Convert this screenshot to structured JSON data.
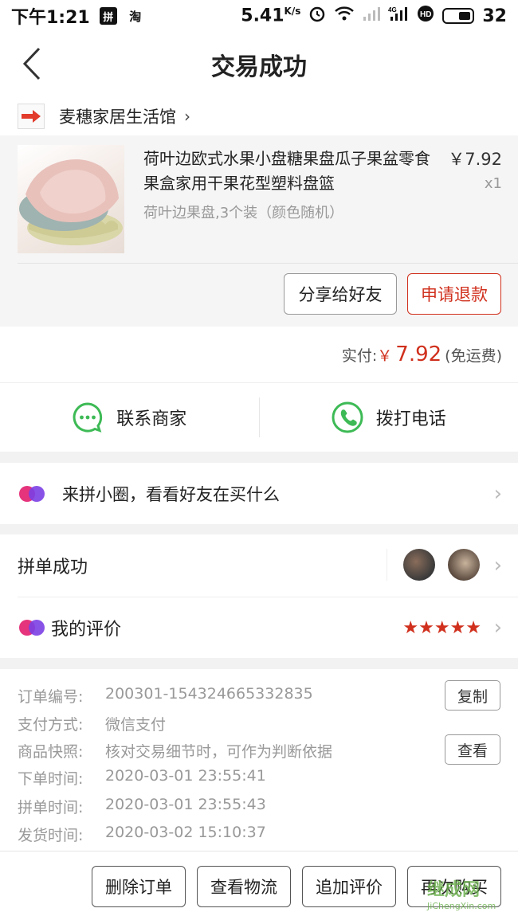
{
  "status_bar": {
    "time": "下午1:21",
    "app_badge_1": "拼",
    "app_badge_2": "淘",
    "speed": "5.41",
    "speed_unit": "K/s",
    "battery": "32"
  },
  "header": {
    "title": "交易成功"
  },
  "shop": {
    "name": "麦穗家居生活馆",
    "chevron": "›"
  },
  "product": {
    "title": "荷叶边欧式水果小盘糖果盘瓜子果盆零食果盒家用干果花型塑料盘篮",
    "spec": "荷叶边果盘,3个装（颜色随机）",
    "price": "￥7.92",
    "qty": "x1",
    "share_button": "分享给好友",
    "refund_button": "申请退款"
  },
  "payment": {
    "label": "实付:",
    "currency": "￥",
    "amount": "7.92",
    "note": "(免运费)"
  },
  "contact": {
    "merchant": "联系商家",
    "phone": "拨打电话"
  },
  "circle": {
    "text": "来拼小圈，看看好友在买什么"
  },
  "group": {
    "label": "拼单成功"
  },
  "review": {
    "label": "我的评价",
    "stars": "★★★★★",
    "rating": 5
  },
  "order_info": {
    "order_no_label": "订单编号:",
    "order_no": "200301-154324665332835",
    "copy_button": "复制",
    "pay_method_label": "支付方式:",
    "pay_method": "微信支付",
    "snapshot_label": "商品快照:",
    "snapshot": "核对交易细节时，可作为判断依据",
    "view_button": "查看",
    "order_time_label": "下单时间:",
    "order_time": "2020-03-01 23:55:41",
    "group_time_label": "拼单时间:",
    "group_time": "2020-03-01 23:55:43",
    "ship_time_label": "发货时间:",
    "ship_time": "2020-03-02 15:10:37"
  },
  "bottom_bar": {
    "delete": "删除订单",
    "logistics": "查看物流",
    "add_review": "追加评价",
    "buy_again": "再次购买"
  },
  "watermark": {
    "top": "继成网",
    "bottom": "JiChengXin.com"
  },
  "colors": {
    "accent_red": "#d0301d",
    "wechat_green": "#3dba55",
    "circle_purple": "#7b3fe4"
  }
}
